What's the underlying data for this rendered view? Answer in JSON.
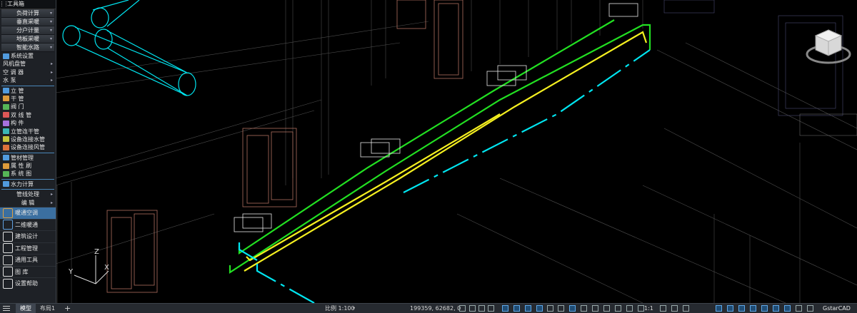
{
  "toolbox": {
    "title": "工具箱",
    "dropdowns": [
      "负荷计算",
      "垂直采暖",
      "分户计量",
      "地板采暖",
      "智能水路"
    ],
    "items_a": [
      {
        "label": "系统设置",
        "icon": "gear-icon",
        "arrow": false
      },
      {
        "label": "风机盘管",
        "icon": "",
        "arrow": true
      },
      {
        "label": "空 调 器",
        "icon": "",
        "arrow": true
      },
      {
        "label": "水    泵",
        "icon": "",
        "arrow": true
      }
    ],
    "items_b": [
      {
        "label": "立    管",
        "icon": "riser-pipe-icon"
      },
      {
        "label": "干    管",
        "icon": "main-pipe-icon"
      },
      {
        "label": "阀    门",
        "icon": "valve-icon"
      },
      {
        "label": "双 线 管",
        "icon": "double-line-pipe-icon"
      },
      {
        "label": "构    件",
        "icon": "component-icon"
      },
      {
        "label": "立管连干管",
        "icon": "connect-riser-icon"
      },
      {
        "label": "设备连接水管",
        "icon": "connect-water-icon"
      },
      {
        "label": "设备连接风管",
        "icon": "connect-duct-icon"
      }
    ],
    "items_c": [
      {
        "label": "管材管理",
        "icon": "pipe-material-icon"
      },
      {
        "label": "属 性 刷",
        "icon": "property-brush-icon"
      },
      {
        "label": "系 统 图",
        "icon": "system-diagram-icon"
      }
    ],
    "items_d": [
      {
        "label": "水力计算",
        "icon": "hydraulic-calc-icon"
      }
    ],
    "items_e": [
      {
        "label": "管线处理"
      },
      {
        "label": "编    辑"
      }
    ],
    "big_buttons": [
      {
        "label": "暖通空调",
        "icon": "hvac-icon",
        "active": true
      },
      {
        "label": "二维暖通",
        "icon": "hvac-2d-icon",
        "active": false
      },
      {
        "label": "建筑设计",
        "icon": "architecture-icon",
        "active": false
      },
      {
        "label": "工程管理",
        "icon": "project-management-icon",
        "active": false
      },
      {
        "label": "通用工具",
        "icon": "general-tools-icon",
        "active": false
      },
      {
        "label": "图    库",
        "icon": "library-icon",
        "active": false
      },
      {
        "label": "设置帮助",
        "icon": "help-settings-icon",
        "active": false
      }
    ]
  },
  "ucs": {
    "z": "Z",
    "y": "Y",
    "x": "X"
  },
  "status": {
    "tab_model": "模型",
    "tab_layout": "布局1",
    "add_tab": "+",
    "scale": "比例 1:100",
    "coords": "199359, 62682, 0",
    "annotation_scale": "1:1",
    "brand": "GstarCAD"
  },
  "colors": {
    "cyan": "#00e5f0",
    "green": "#22e022",
    "yellow": "#f5f020",
    "door": "#b07060",
    "white_line": "#d8d8d8",
    "panel_bg": "#1e2126",
    "accent": "#3b6fa0"
  }
}
